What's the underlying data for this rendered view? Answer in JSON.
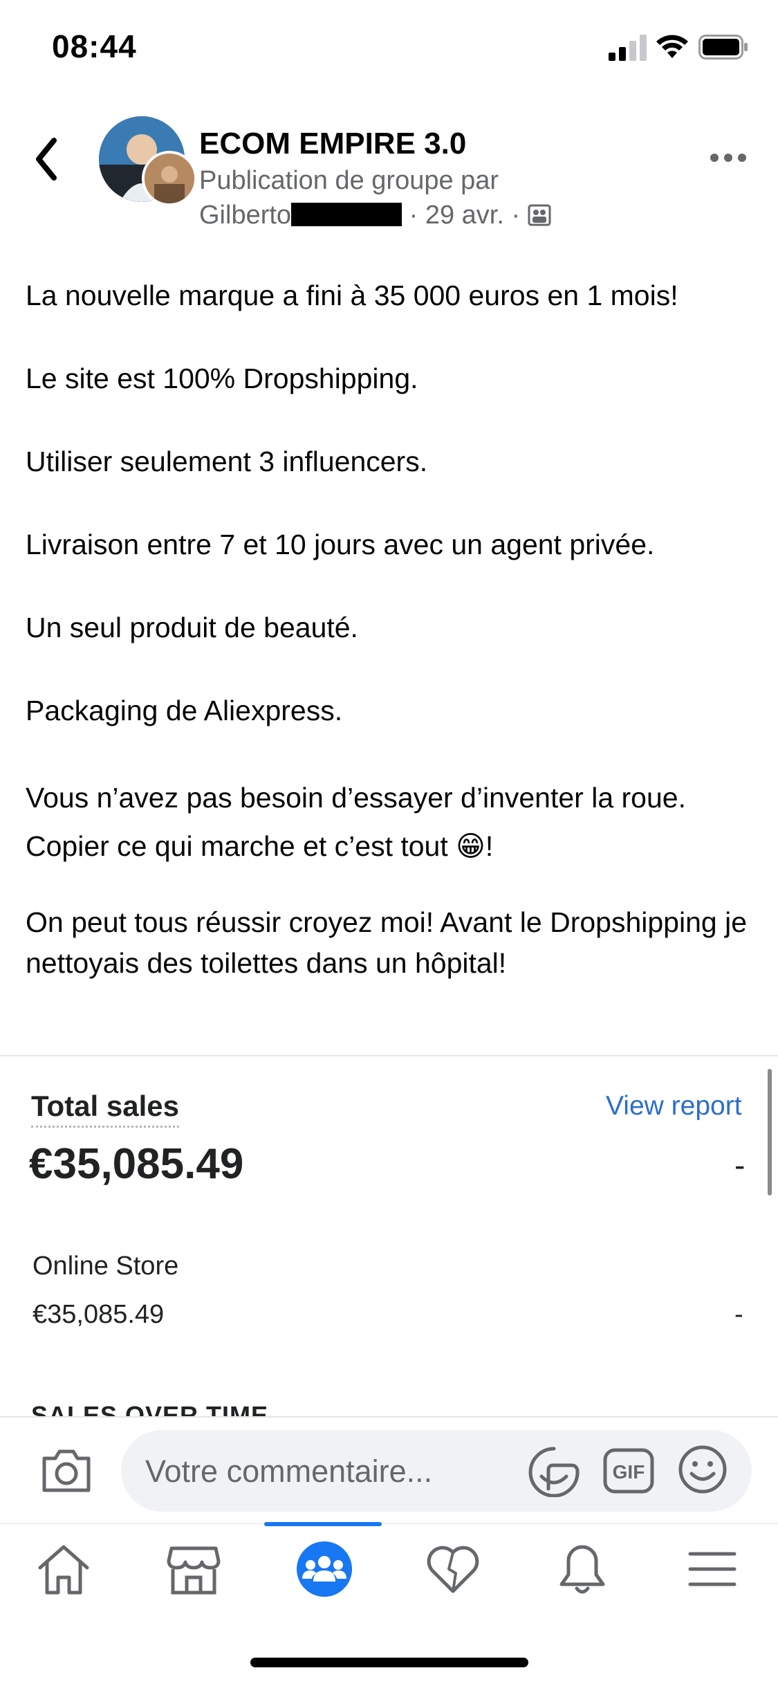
{
  "status_bar": {
    "time": "08:44"
  },
  "header": {
    "group_name": "ECOM EMPIRE 3.0",
    "subtitle": "Publication de groupe par",
    "author": "Gilberto",
    "date": "· 29 avr. ·"
  },
  "post": {
    "paragraphs": [
      "La nouvelle marque a fini à 35 000 euros en 1 mois!",
      "Le site est 100% Dropshipping.",
      "Utiliser seulement 3 influencers.",
      "Livraison entre 7 et 10 jours avec un agent privée.",
      "Un seul produit de beauté.",
      "Packaging de Aliexpress.",
      "Vous n’avez pas besoin d’essayer d’inventer la roue. Copier ce qui marche et c’est tout 😁!",
      "On peut tous réussir croyez moi! Avant le Dropshipping je nettoyais des toilettes dans un hôpital!"
    ]
  },
  "screenshot": {
    "total_sales_label": "Total sales",
    "view_report": "View report",
    "total_value": "€35,085.49",
    "total_change": "-",
    "online_store_label": "Online Store",
    "online_store_value": "€35,085.49",
    "online_store_change": "-",
    "sales_over_time": "SALES OVER TIME"
  },
  "comment_bar": {
    "placeholder": "Votre commentaire..."
  },
  "tab_bar": {
    "tabs": [
      "home-icon",
      "marketplace-icon",
      "groups-icon",
      "dating-icon",
      "notifications-icon",
      "menu-icon"
    ],
    "active": "groups-icon",
    "accent": "#1877f2"
  }
}
